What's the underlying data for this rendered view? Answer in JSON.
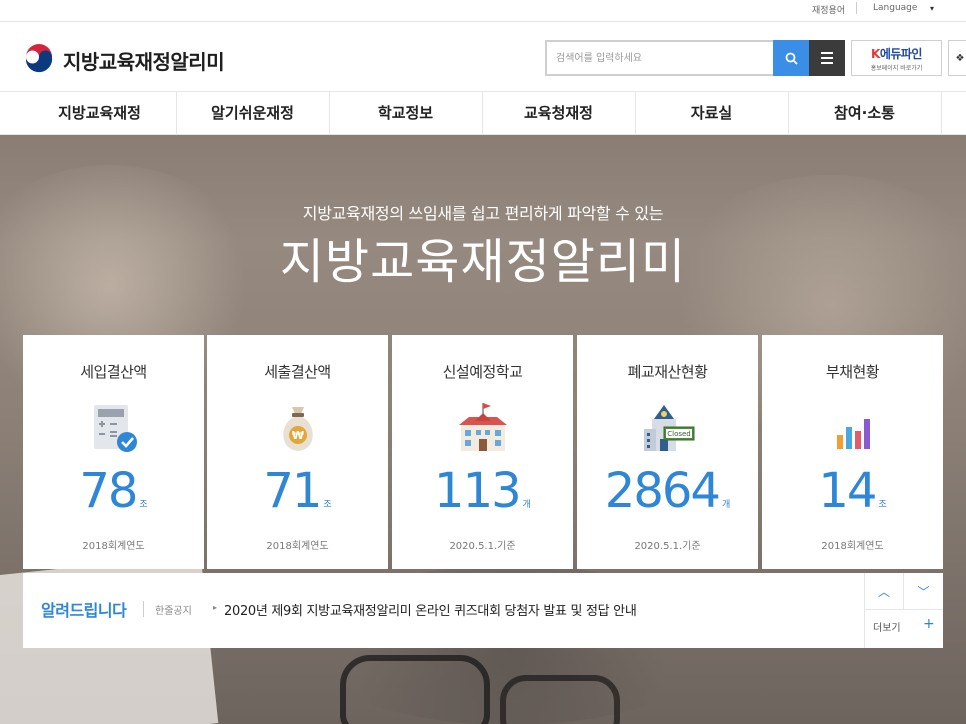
{
  "utility": {
    "glossary": "재정용어",
    "language": "Language"
  },
  "header": {
    "site_title": "지방교육재정알리미",
    "search_placeholder": "검색어를 입력하세요",
    "edufine_brand_k": "K",
    "edufine_brand": "에듀파인",
    "edufine_sub": "홍보페이지 바로가기"
  },
  "nav": {
    "items": [
      "지방교육재정",
      "알기쉬운재정",
      "학교정보",
      "교육청재정",
      "자료실",
      "참여·소통"
    ]
  },
  "hero": {
    "subtitle": "지방교육재정의 쓰임새를 쉽고 편리하게 파악할 수 있는",
    "title": "지방교육재정알리미"
  },
  "cards": [
    {
      "label": "세입결산액",
      "value": "78",
      "unit": "조",
      "note": "2018회계연도",
      "icon": "calculator-check-icon"
    },
    {
      "label": "세출결산액",
      "value": "71",
      "unit": "조",
      "note": "2018회계연도",
      "icon": "won-money-bag-icon"
    },
    {
      "label": "신설예정학교",
      "value": "113",
      "unit": "개",
      "note": "2020.5.1.기준",
      "icon": "school-building-icon"
    },
    {
      "label": "폐교재산현황",
      "value": "2864",
      "unit": "개",
      "note": "2020.5.1.기준",
      "icon": "closed-school-icon",
      "icon_text": "Closed"
    },
    {
      "label": "부채현황",
      "value": "14",
      "unit": "조",
      "note": "2018회계연도",
      "icon": "bar-chart-icon"
    }
  ],
  "notice": {
    "heading": "알려드립니다",
    "category": "한줄공지",
    "title": "2020년 제9회 지방교육재정알리미 온라인 퀴즈대회 당첨자 발표 및 정답 안내",
    "more": "더보기"
  },
  "colors": {
    "accent": "#2e86d6",
    "search_button": "#3a8ee6",
    "menu_button": "#3b3b3b"
  }
}
